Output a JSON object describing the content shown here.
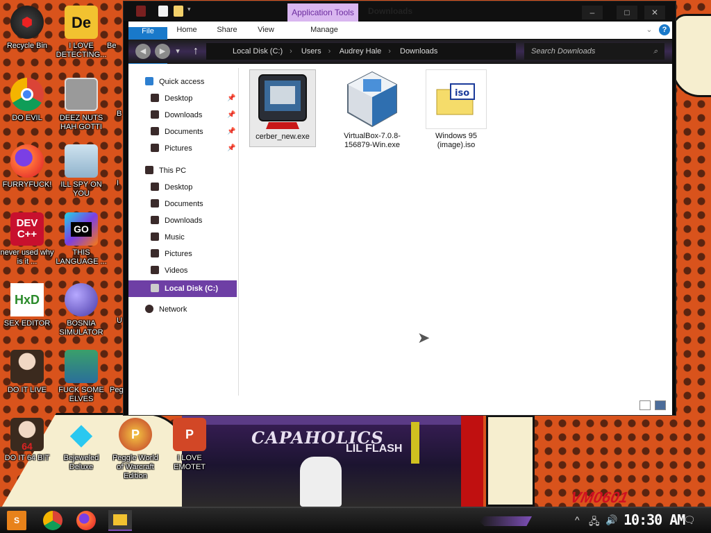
{
  "desktop": {
    "icons": [
      {
        "label": "Recycle Bin",
        "icon": "recycle-bin-icon"
      },
      {
        "label": "I LOVE DETECTING...",
        "icon": "die-icon"
      },
      {
        "label": "DO EVIL",
        "icon": "chrome-icon"
      },
      {
        "label": "DEEZ NUTS HAH GOTTI",
        "icon": "window-stack-icon"
      },
      {
        "label": "FURRYFUCK!",
        "icon": "firefox-icon"
      },
      {
        "label": "ILL SPY ON YOU",
        "icon": "network-spy-icon"
      },
      {
        "label": "never used why is it ...",
        "icon": "devcpp-icon"
      },
      {
        "label": "THIS LANGUAGE ...",
        "icon": "goland-icon"
      },
      {
        "label": "SEX EDITOR",
        "icon": "hxd-icon"
      },
      {
        "label": "BOSNIA SIMULATOR",
        "icon": "mine-icon"
      },
      {
        "label": "DO IT LIVE",
        "icon": "portrait-icon"
      },
      {
        "label": "FUCK SOME ELVES",
        "icon": "wizard-icon"
      },
      {
        "label": "DO IT 64 BIT",
        "icon": "portrait64-icon"
      },
      {
        "label": "Bejeweled Deluxe",
        "icon": "bejeweled-icon"
      },
      {
        "label": "Peggle World of Warcraft Edition",
        "icon": "peggle-icon"
      },
      {
        "label": "I LOVE EMOTET",
        "icon": "powerpoint-icon"
      }
    ],
    "partial": [
      "Be",
      "B",
      "I",
      "U",
      "Peg"
    ]
  },
  "wallpaper": {
    "poster_title": "CAPAHOLICS",
    "poster_sub": "LIL FLASH",
    "tag": "VM0601"
  },
  "window": {
    "title": "Downloads",
    "context_tab": "Application Tools",
    "ribbon_tabs": [
      "File",
      "Home",
      "Share",
      "View",
      "Manage"
    ],
    "controls": {
      "minimize": "–",
      "maximize": "□",
      "close": "✕"
    },
    "address": [
      "Local Disk (C:)",
      "Users",
      "Audrey Hale",
      "Downloads"
    ],
    "search_placeholder": "Search Downloads",
    "nav": {
      "quick_access": "Quick access",
      "quick_items": [
        "Desktop",
        "Downloads",
        "Documents",
        "Pictures"
      ],
      "this_pc": "This PC",
      "pc_items": [
        "Desktop",
        "Documents",
        "Downloads",
        "Music",
        "Pictures",
        "Videos"
      ],
      "local_disk": "Local Disk (C:)",
      "network": "Network"
    },
    "files": [
      {
        "name": "cerber_new.exe",
        "icon": "monitor-app-icon",
        "selected": true
      },
      {
        "name": "VirtualBox-7.0.8-156879-Win.exe",
        "icon": "virtualbox-icon",
        "selected": false
      },
      {
        "name": "Windows 95 (image).iso",
        "icon": "iso-icon",
        "selected": false
      }
    ]
  },
  "taskbar": {
    "clock": "10:30 AM"
  },
  "colors": {
    "accent": "#6e3fa5",
    "file_tab": "#1979ca",
    "app_tools": "#d9b6f0"
  }
}
